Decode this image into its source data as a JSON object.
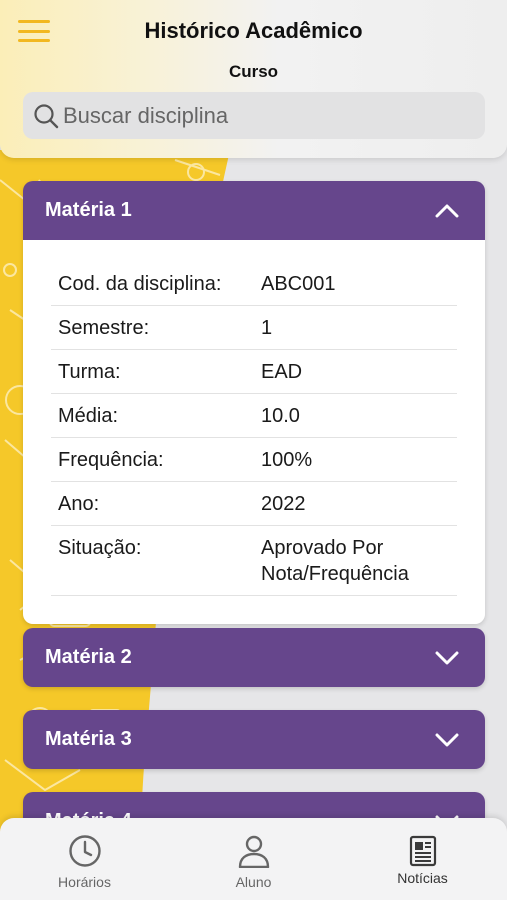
{
  "header": {
    "title": "Histórico Acadêmico",
    "subtitle": "Curso",
    "search_placeholder": "Buscar disciplina"
  },
  "subjects": [
    {
      "name": "Matéria 1",
      "expanded": true,
      "details": [
        {
          "label": "Cod. da disciplina:",
          "value": "ABC001"
        },
        {
          "label": "Semestre:",
          "value": "1"
        },
        {
          "label": "Turma:",
          "value": "EAD"
        },
        {
          "label": "Média:",
          "value": "10.0"
        },
        {
          "label": "Frequência:",
          "value": "100%"
        },
        {
          "label": "Ano:",
          "value": "2022"
        },
        {
          "label": "Situação:",
          "value": "Aprovado Por Nota/Frequência"
        }
      ]
    },
    {
      "name": "Matéria 2",
      "expanded": false
    },
    {
      "name": "Matéria 3",
      "expanded": false
    },
    {
      "name": "Matéria 4",
      "expanded": false
    }
  ],
  "bottom_nav": [
    {
      "label": "Horários",
      "icon": "clock-icon"
    },
    {
      "label": "Aluno",
      "icon": "user-icon"
    },
    {
      "label": "Notícias",
      "icon": "newspaper-icon",
      "active": true
    }
  ],
  "colors": {
    "accent_purple": "#66468c",
    "accent_yellow": "#f5c829",
    "menu_yellow": "#f2b820"
  }
}
